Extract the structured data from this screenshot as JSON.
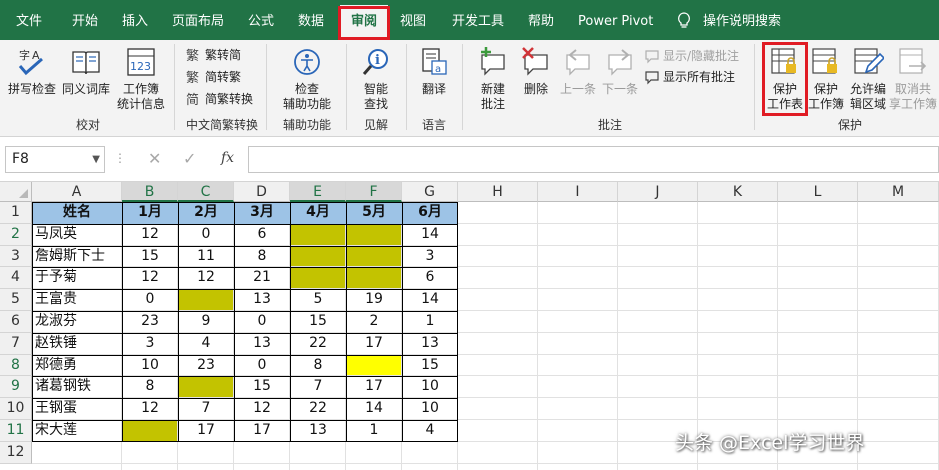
{
  "ribbon_tabs": [
    {
      "label": "文件",
      "active": false
    },
    {
      "label": "开始",
      "active": false
    },
    {
      "label": "插入",
      "active": false
    },
    {
      "label": "页面布局",
      "active": false
    },
    {
      "label": "公式",
      "active": false
    },
    {
      "label": "数据",
      "active": false
    },
    {
      "label": "审阅",
      "active": true
    },
    {
      "label": "视图",
      "active": false
    },
    {
      "label": "开发工具",
      "active": false
    },
    {
      "label": "帮助",
      "active": false
    },
    {
      "label": "Power Pivot",
      "active": false
    },
    {
      "label": "操作说明搜索",
      "active": false
    }
  ],
  "ribbon": {
    "groups": {
      "proofing": "校对",
      "chinese_conversion": "中文简繁转换",
      "accessibility": "辅助功能",
      "insights": "见解",
      "language": "语言",
      "comments": "批注",
      "protect": "保护"
    },
    "buttons": {
      "spelling": "拼写检查",
      "thesaurus": "同义词库",
      "workbook_stats": [
        "工作簿",
        "统计信息"
      ],
      "to_traditional": "繁转简",
      "to_simplified": "简转繁",
      "convert": "简繁转换",
      "check_accessibility": [
        "检查",
        "辅助功能"
      ],
      "smart_lookup": [
        "智能",
        "查找"
      ],
      "translate": "翻译",
      "new_comment": [
        "新建",
        "批注"
      ],
      "delete": "删除",
      "previous": "上一条",
      "next": "下一条",
      "show_hide_comment": "显示/隐藏批注",
      "show_all_comments": "显示所有批注",
      "protect_sheet": [
        "保护",
        "工作表"
      ],
      "protect_workbook": [
        "保护",
        "工作簿"
      ],
      "allow_edit_ranges": [
        "允许编",
        "辑区域"
      ],
      "unshare_workbook": [
        "取消共",
        "享工作簿"
      ]
    }
  },
  "formula_bar": {
    "name_box": "F8",
    "cancel_symbol": "✕",
    "enter_symbol": "✓",
    "fx": "fx",
    "formula": ""
  },
  "colors": {
    "ribbon_green": "#217346",
    "header_blue": "#9dc3e6",
    "olive_fill": "#c3c300",
    "yellow_fill": "#ffff00",
    "highlight_red": "#e01b24"
  },
  "columns": [
    "A",
    "B",
    "C",
    "D",
    "E",
    "F",
    "G",
    "H",
    "I",
    "J",
    "K",
    "L",
    "M"
  ],
  "rows": [
    "1",
    "2",
    "3",
    "4",
    "5",
    "6",
    "7",
    "8",
    "9",
    "10",
    "11",
    "12"
  ],
  "table": {
    "headers": [
      "姓名",
      "1月",
      "2月",
      "3月",
      "4月",
      "5月",
      "6月"
    ],
    "rows": [
      [
        "马凤英",
        "12",
        "0",
        "6",
        "",
        "",
        "14"
      ],
      [
        "詹姆斯下士",
        "15",
        "11",
        "8",
        "",
        "",
        "3"
      ],
      [
        "于予菊",
        "12",
        "12",
        "21",
        "",
        "",
        "6"
      ],
      [
        "王富贵",
        "0",
        "",
        "13",
        "5",
        "19",
        "14"
      ],
      [
        "龙淑芬",
        "23",
        "9",
        "0",
        "15",
        "2",
        "1"
      ],
      [
        "赵铁锤",
        "3",
        "4",
        "13",
        "22",
        "17",
        "13"
      ],
      [
        "郑德勇",
        "10",
        "23",
        "0",
        "8",
        "",
        "15"
      ],
      [
        "诸葛钢铁",
        "8",
        "",
        "15",
        "7",
        "17",
        "10"
      ],
      [
        "王钢蛋",
        "12",
        "7",
        "12",
        "22",
        "14",
        "10"
      ],
      [
        "宋大莲",
        "",
        "17",
        "17",
        "13",
        "1",
        "4"
      ]
    ]
  },
  "watermark": "头条 @Excel学习世界"
}
